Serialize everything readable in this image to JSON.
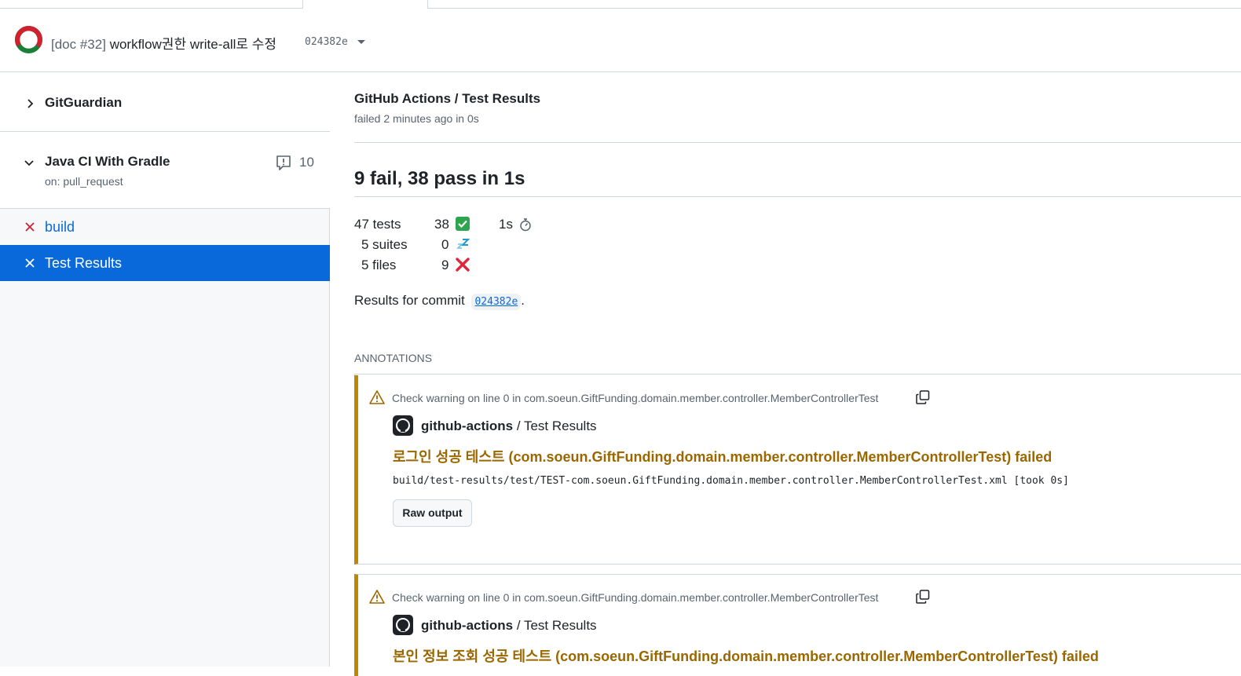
{
  "header": {
    "title_prefix": "[doc #32]",
    "title": "workflow권한 write-all로 수정",
    "commit_sha": "024382e",
    "status_ring_colors": {
      "failed": "#cf222e",
      "success": "#1a7f37"
    }
  },
  "sidebar": {
    "groups": [
      {
        "name": "GitGuardian",
        "expanded": false
      },
      {
        "name": "Java CI With Gradle",
        "trigger": "on: pull_request",
        "comment_count": "10",
        "expanded": true
      }
    ],
    "jobs": [
      {
        "label": "build",
        "status": "failed",
        "selected": false
      },
      {
        "label": "Test Results",
        "status": "failed",
        "selected": true
      }
    ]
  },
  "main": {
    "breadcrumb": "GitHub Actions / Test Results",
    "status_line": "failed 2 minutes ago in 0s",
    "summary": "9 fail, 38 pass in 1s",
    "stats": {
      "tests": "47 tests",
      "suites": "5 suites",
      "files": "5 files",
      "passed": "38",
      "skipped": "0",
      "failed": "9",
      "duration": "1s"
    },
    "commit_prefix": "Results for commit",
    "commit_sha": "024382e",
    "commit_suffix": ".",
    "annotations_heading": "ANNOTATIONS",
    "annotations": [
      {
        "warning": "Check warning on line 0 in com.soeun.GiftFunding.domain.member.controller.MemberControllerTest",
        "author": "github-actions",
        "source": " / Test Results",
        "title": "로그인 성공 테스트 (com.soeun.GiftFunding.domain.member.controller.MemberControllerTest) failed",
        "path": "build/test-results/test/TEST-com.soeun.GiftFunding.domain.member.controller.MemberControllerTest.xml [took 0s]",
        "button": "Raw output"
      },
      {
        "warning": "Check warning on line 0 in com.soeun.GiftFunding.domain.member.controller.MemberControllerTest",
        "author": "github-actions",
        "source": " / Test Results",
        "title": "본인 정보 조회 성공 테스트 (com.soeun.GiftFunding.domain.member.controller.MemberControllerTest) failed"
      }
    ]
  }
}
